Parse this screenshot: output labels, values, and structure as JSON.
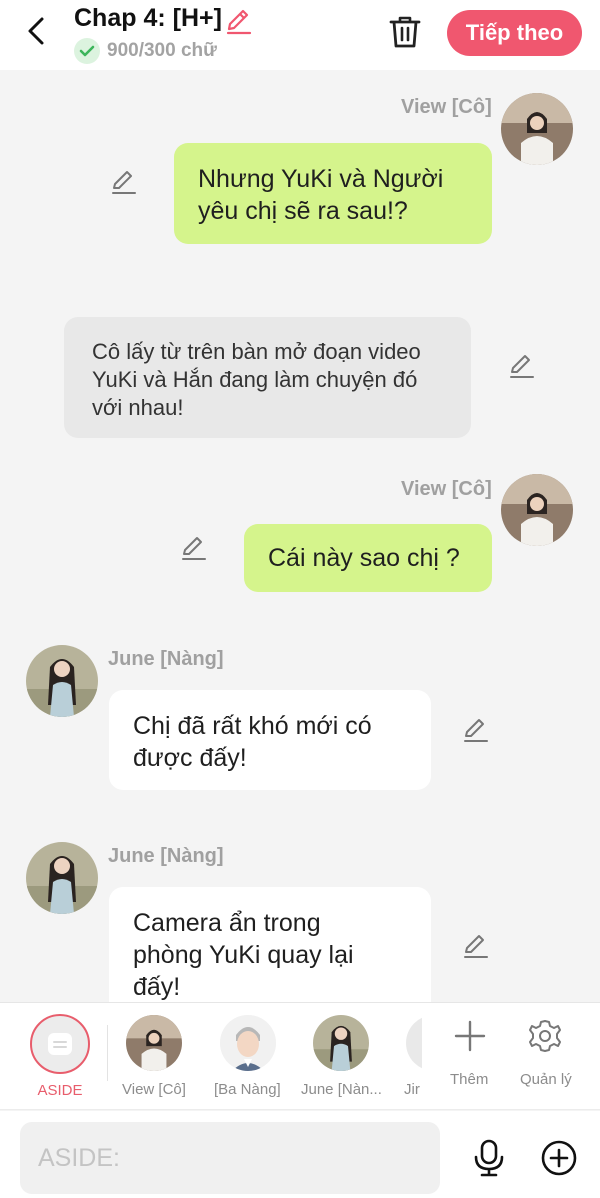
{
  "header": {
    "title": "Chap 4: [H+]",
    "word_count": "900/300 chữ",
    "next_label": "Tiếp theo",
    "accent_color": "#f0576f",
    "icons": [
      "back-arrow-icon",
      "pencil-icon",
      "check-icon",
      "trash-icon"
    ]
  },
  "messages": [
    {
      "side": "right",
      "sender": "View [Cô]",
      "text_lines": [
        "Nhưng YuKi và Người",
        "yêu chị sẽ ra sau!?"
      ],
      "style": "green"
    },
    {
      "side": "center",
      "sender": "",
      "text_lines": [
        "Cô lấy từ trên bàn mở đoạn video",
        "YuKi và Hắn đang làm chuyện đó",
        "với nhau!"
      ],
      "style": "gray"
    },
    {
      "side": "right",
      "sender": "View [Cô]",
      "text_lines": [
        "Cái này sao chị ?"
      ],
      "style": "green"
    },
    {
      "side": "left",
      "sender": "June [Nàng]",
      "text_lines": [
        "Chị đã rất khó mới có",
        "được đấy!"
      ],
      "style": "white"
    },
    {
      "side": "left",
      "sender": "June [Nàng]",
      "text_lines": [
        "Camera ẩn trong",
        "phòng YuKi quay lại",
        "đấy!"
      ],
      "style": "white"
    }
  ],
  "characters": [
    {
      "label": "ASIDE",
      "active": true,
      "icon": "message-icon"
    },
    {
      "label": "View [Cô]",
      "active": false
    },
    {
      "label": "[Ba Nàng]",
      "active": false
    },
    {
      "label": "June [Nàn...",
      "active": false
    },
    {
      "label": "Jir",
      "active": false
    }
  ],
  "tools": [
    {
      "label": "Thêm",
      "icon": "plus-icon"
    },
    {
      "label": "Quản lý",
      "icon": "gear-icon"
    }
  ],
  "input": {
    "placeholder": "ASIDE:",
    "icons": [
      "microphone-icon",
      "add-circle-icon"
    ]
  },
  "colors": {
    "green_bubble": "#d5f48c",
    "gray_bubble": "#e8e8e8",
    "white_bubble": "#ffffff",
    "background": "#f4f4f4",
    "aside_ring": "#e85d6c"
  }
}
